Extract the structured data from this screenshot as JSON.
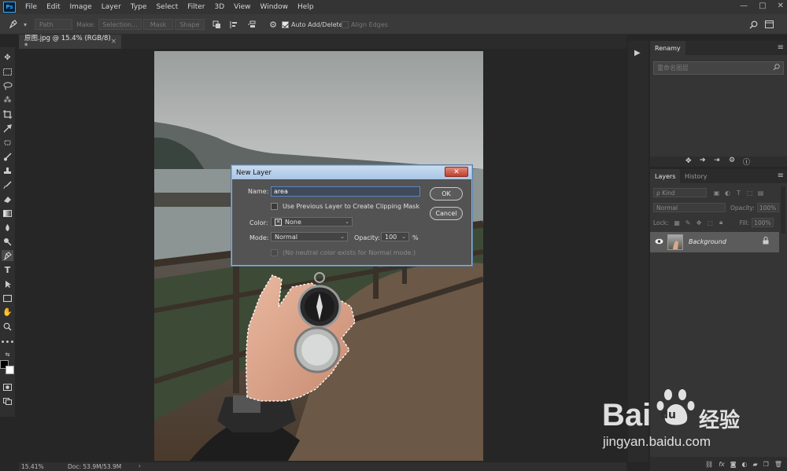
{
  "menubar": {
    "app_icon": "Ps",
    "items": [
      "File",
      "Edit",
      "Image",
      "Layer",
      "Type",
      "Select",
      "Filter",
      "3D",
      "View",
      "Window",
      "Help"
    ],
    "window_controls": [
      "—",
      "□",
      "✕"
    ]
  },
  "options_bar": {
    "tool_icon": "pen-icon",
    "mode_select": "Path",
    "make_label": "Make:",
    "selection_btn": "Selection...",
    "mask_btn": "Mask",
    "shape_btn": "Shape",
    "auto_add_delete": "Auto Add/Delete",
    "auto_add_delete_checked": true,
    "align_edges": "Align Edges",
    "align_edges_checked": false
  },
  "document": {
    "tab_title": "原图.jpg @ 15.4% (RGB/8) *",
    "close": "×",
    "zoom": "15.41%",
    "doc_size": "Doc: 53.9M/53.9M"
  },
  "dialog": {
    "title": "New Layer",
    "close": "✕",
    "name_label": "Name:",
    "name_value": "area",
    "clip_label": "Use Previous Layer to Create Clipping Mask",
    "clip_checked": false,
    "color_label": "Color:",
    "color_value": "None",
    "mode_label": "Mode:",
    "mode_value": "Normal",
    "opacity_label": "Opacity:",
    "opacity_value": "100",
    "opacity_unit": "%",
    "neutral_label": "(No neutral color exists for Normal mode.)",
    "ok": "OK",
    "cancel": "Cancel"
  },
  "right_panel": {
    "renamy_tab": "Renamy",
    "renamy_search_placeholder": "重命名图层",
    "layers_tab": "Layers",
    "history_tab": "History",
    "kind_label": "ρ Kind",
    "blend_mode": "Normal",
    "opacity_label": "Opacity:",
    "opacity_value": "100%",
    "lock_label": "Lock:",
    "fill_label": "Fill:",
    "fill_value": "100%",
    "layer_name": "Background"
  },
  "watermark": {
    "brand": "Bai",
    "brand2": "du",
    "cn": "经验",
    "url": "jingyan.baidu.com"
  },
  "colors": {
    "accent": "#31a8ff",
    "dialog_title": "#b9d1ec",
    "watermark": "#ffffff"
  }
}
